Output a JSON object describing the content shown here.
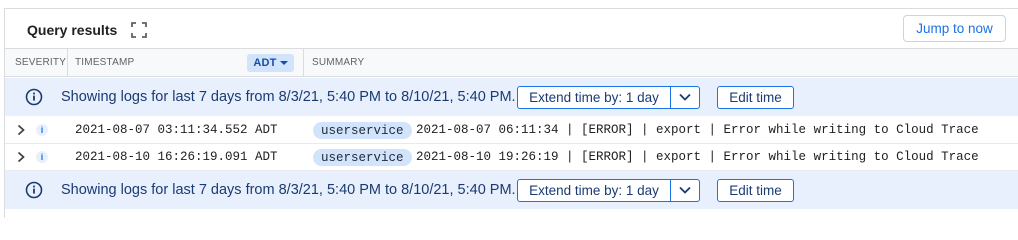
{
  "header": {
    "title": "Query results",
    "jump_label": "Jump to now"
  },
  "columns": {
    "severity": "SEVERITY",
    "timestamp": "TIMESTAMP",
    "timezone": "ADT",
    "summary": "SUMMARY"
  },
  "banner": {
    "message": "Showing logs for last 7 days from 8/3/21, 5:40 PM to 8/10/21, 5:40 PM.",
    "extend_label": "Extend time by: 1 day",
    "edit_label": "Edit time"
  },
  "rows": [
    {
      "severity": "i",
      "timestamp": "2021-08-07 03:11:34.552 ADT",
      "service": "userservice",
      "summary": "2021-08-07 06:11:34 | [ERROR] | export | Error while writing to Cloud Trace"
    },
    {
      "severity": "i",
      "timestamp": "2021-08-10 16:26:19.091 ADT",
      "service": "userservice",
      "summary": "2021-08-10 19:26:19 | [ERROR] | export | Error while writing to Cloud Trace"
    }
  ],
  "colors": {
    "accent": "#1a73e8",
    "banner_bg": "#e8f0fe",
    "chip_bg": "#d2e3fc"
  },
  "icons": [
    "expand-icon",
    "info-icon",
    "chevron-right-icon",
    "chevron-down-icon",
    "severity-info-icon"
  ]
}
